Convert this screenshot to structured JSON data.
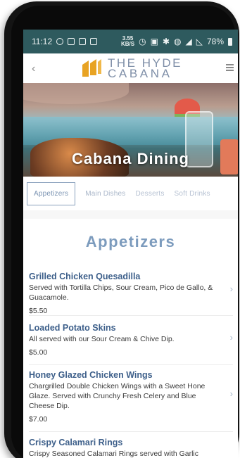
{
  "status_bar": {
    "time": "11:12",
    "speed_value": "3.55",
    "speed_unit": "KB/S",
    "battery": "78%"
  },
  "header": {
    "logo_line1": "THE HYDE",
    "logo_line2": "CABANA",
    "brand_color": "#e8a323"
  },
  "hero": {
    "title": "Cabana Dining"
  },
  "tabs": [
    {
      "label": "Appetizers",
      "active": true
    },
    {
      "label": "Main Dishes",
      "active": false
    },
    {
      "label": "Desserts",
      "active": false
    },
    {
      "label": "Soft Drinks",
      "active": false
    }
  ],
  "section": {
    "title": "Appetizers"
  },
  "items": [
    {
      "name": "Grilled Chicken Quesadilla",
      "description": "Served with Tortilla Chips, Sour Cream, Pico de Gallo, & Guacamole.",
      "price": "$5.50"
    },
    {
      "name": "Loaded Potato Skins",
      "description": "All served with our Sour Cream & Chive Dip.",
      "price": "$5.00"
    },
    {
      "name": "Honey Glazed Chicken Wings",
      "description": "Chargrilled Double Chicken Wings with a Sweet Hone Glaze. Served with Crunchy Fresh Celery and Blue Cheese Dip.",
      "price": "$7.00"
    },
    {
      "name": "Crispy Calamari Rings",
      "description": "Crispy Seasoned Calamari Rings served with Garlic",
      "price": ""
    }
  ]
}
